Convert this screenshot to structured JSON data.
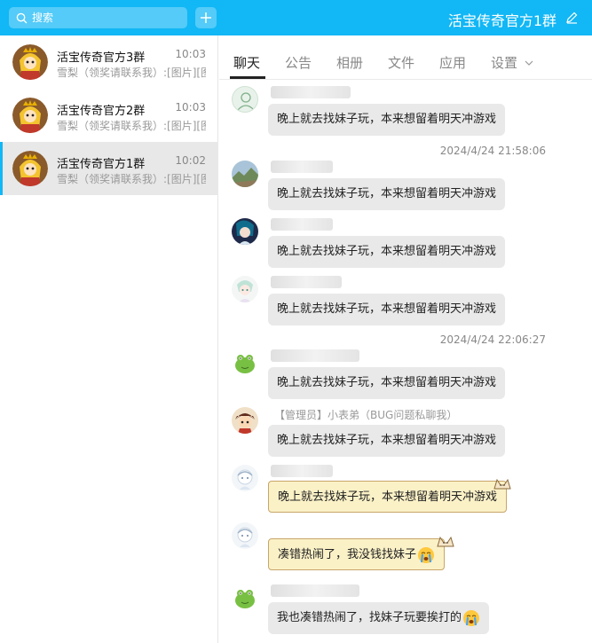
{
  "search": {
    "placeholder": "搜索"
  },
  "header": {
    "group_title": "活宝传奇官方1群"
  },
  "conversations": [
    {
      "name": "活宝传奇官方3群",
      "time": "10:03",
      "preview": "雪梨（领奖请联系我）:[图片][图"
    },
    {
      "name": "活宝传奇官方2群",
      "time": "10:03",
      "preview": "雪梨（领奖请联系我）:[图片][图"
    },
    {
      "name": "活宝传奇官方1群",
      "time": "10:02",
      "preview": "雪梨（领奖请联系我）:[图片][图"
    }
  ],
  "tabs": [
    {
      "label": "聊天"
    },
    {
      "label": "公告"
    },
    {
      "label": "相册"
    },
    {
      "label": "文件"
    },
    {
      "label": "应用"
    },
    {
      "label": "设置"
    }
  ],
  "messages": [
    {
      "text": "晚上就去找妹子玩，本来想留着明天冲游戏"
    },
    {
      "timestamp": "2024/4/24 21:58:06"
    },
    {
      "text": "晚上就去找妹子玩，本来想留着明天冲游戏"
    },
    {
      "text": "晚上就去找妹子玩，本来想留着明天冲游戏"
    },
    {
      "text": "晚上就去找妹子玩，本来想留着明天冲游戏"
    },
    {
      "timestamp": "2024/4/24 22:06:27"
    },
    {
      "text": "晚上就去找妹子玩，本来想留着明天冲游戏"
    },
    {
      "sender": "【管理员】小表弟（BUG问题私聊我）",
      "text": "晚上就去找妹子玩，本来想留着明天冲游戏"
    },
    {
      "text": "晚上就去找妹子玩，本来想留着明天冲游戏"
    },
    {
      "text": "凑错热闹了，我没钱找妹子"
    },
    {
      "text": "我也凑错热闹了，找妹子玩要挨打的"
    }
  ],
  "colors": {
    "accent": "#12b7f5",
    "bubble": "#e9e9e9",
    "special_bubble": "#fbf1c7"
  }
}
